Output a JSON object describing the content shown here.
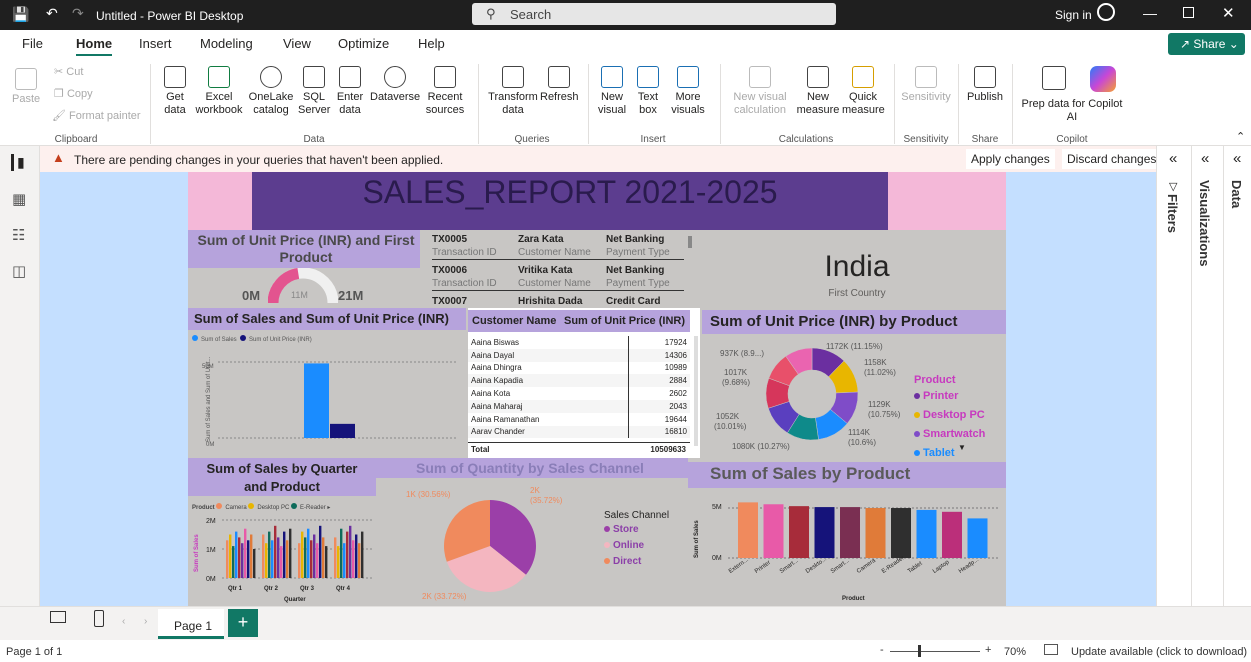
{
  "window": {
    "title": "Untitled - Power BI Desktop",
    "search": "Search",
    "sign_in": "Sign in"
  },
  "menu_tabs": [
    "File",
    "Home",
    "Insert",
    "Modeling",
    "View",
    "Optimize",
    "Help"
  ],
  "share_label": "Share",
  "ribbon": {
    "clipboard": {
      "paste": "Paste",
      "cut": "Cut",
      "copy": "Copy",
      "format_painter": "Format painter",
      "group": "Clipboard"
    },
    "data": {
      "get_data": "Get data",
      "excel": "Excel workbook",
      "onelake": "OneLake catalog",
      "sql": "SQL Server",
      "enter": "Enter data",
      "dataverse": "Dataverse",
      "recent": "Recent sources",
      "group": "Data"
    },
    "queries": {
      "transform": "Transform data",
      "refresh": "Refresh",
      "group": "Queries"
    },
    "insert": {
      "new_visual": "New visual",
      "text_box": "Text box",
      "more_visuals": "More visuals",
      "group": "Insert"
    },
    "calculations": {
      "new_visual_calc": "New visual calculation",
      "new_measure": "New measure",
      "quick_measure": "Quick measure",
      "group": "Calculations"
    },
    "sensitivity": {
      "label": "Sensitivity",
      "group": "Sensitivity"
    },
    "share": {
      "publish": "Publish",
      "group": "Share"
    },
    "copilot": {
      "prep": "Prep data for Copilot AI",
      "group": "Copilot"
    }
  },
  "warning": {
    "text": "There are pending changes in your queries that haven't been applied.",
    "apply": "Apply changes",
    "discard": "Discard changes"
  },
  "panes": {
    "filters": "Filters",
    "visualizations": "Visualizations",
    "data": "Data"
  },
  "report": {
    "title": "SALES_REPORT 2021-2025",
    "gauge": {
      "title": "Sum of Unit Price (INR) and First Product",
      "min": "0M",
      "mid": "11M",
      "max": "21M",
      "value_fraction": 0.45
    },
    "transactions": [
      {
        "id": "TX0005",
        "name": "Zara Kata",
        "payment": "Net Banking"
      },
      {
        "id": "TX0006",
        "name": "Vritika Kata",
        "payment": "Net Banking"
      },
      {
        "id": "TX0007",
        "name": "Hrishita Dada",
        "payment": "Credit Card"
      }
    ],
    "transaction_labels": {
      "id": "Transaction ID",
      "name": "Customer Name",
      "payment": "Payment Type"
    },
    "country_card": {
      "value": "India",
      "label": "First Country"
    },
    "sales_unit_chart": {
      "title": "Sum of Sales and Sum of Unit Price (INR)",
      "legend_sales": "Sum of Sales",
      "legend_unit": "Sum of Unit Price (INR)",
      "ylabel": "Sum of Sales and Sum of Unit...",
      "tick_50m": "50M",
      "tick_0m": "0M"
    },
    "customer_table": {
      "headers": [
        "Customer Name",
        "Sum of Unit Price (INR)"
      ],
      "rows": [
        [
          "Aaina Biswas",
          "17924"
        ],
        [
          "Aaina Dayal",
          "14306"
        ],
        [
          "Aaina Dhingra",
          "10989"
        ],
        [
          "Aaina Kapadia",
          "2884"
        ],
        [
          "Aaina Kota",
          "2602"
        ],
        [
          "Aaina Maharaj",
          "2043"
        ],
        [
          "Aaina Ramanathan",
          "19644"
        ],
        [
          "Aarav Chander",
          "16810"
        ]
      ],
      "total_label": "Total",
      "total_value": "10509633"
    },
    "donut": {
      "title": "Sum of Unit Price (INR) by Product",
      "legend_title": "Product",
      "legend": [
        {
          "name": "Printer",
          "color": "#6b2fa0"
        },
        {
          "name": "Desktop PC",
          "color": "#e8b600"
        },
        {
          "name": "Smartwatch",
          "color": "#7f4cc8"
        },
        {
          "name": "Tablet",
          "color": "#1a8cff"
        }
      ],
      "labels": [
        "1172K (11.15%)",
        "1158K",
        "(11.02%)",
        "1129K",
        "(10.75%)",
        "1114K",
        "(10.6%)",
        "1080K (10.27%)",
        "1052K",
        "(10.01%)",
        "1017K",
        "(9.68%)",
        "937K (8.9...)"
      ]
    },
    "quarter_chart": {
      "title": "Sum of Sales by Quarter and Product",
      "legend_label": "Product",
      "legend": [
        "Camera",
        "Desktop PC",
        "E-Reader"
      ],
      "quarters": [
        "Qtr 1",
        "Qtr 2",
        "Qtr 3",
        "Qtr 4"
      ],
      "xlabel": "Quarter",
      "ylabel": "Sum of Sales",
      "ticks": [
        "2M",
        "1M",
        "0M"
      ]
    },
    "pie": {
      "title": "Sum of Quantity by Sales Channel",
      "legend_title": "Sales Channel",
      "legend": [
        "Store",
        "Online",
        "Direct"
      ],
      "label_direct": "1K (30.56%)",
      "label_store": "2K",
      "label_store2": "(35.72%)",
      "label_online": "2K (33.72%)"
    },
    "product_chart": {
      "title": "Sum of Sales by Product",
      "ylabel": "Sum of Sales",
      "xlabel": "Product",
      "ticks": [
        "5M",
        "0M"
      ]
    }
  },
  "chart_data": [
    {
      "type": "bar",
      "title": "Sum of Sales by Product",
      "categories": [
        "Extern...",
        "Printer",
        "Smart...",
        "Deskto...",
        "Smart...",
        "Camera",
        "E-Reader",
        "Tablet",
        "Laptop",
        "Headp..."
      ],
      "values": [
        5.9,
        5.7,
        5.5,
        5.4,
        5.4,
        5.3,
        5.3,
        5.1,
        4.9,
        4.2
      ],
      "ylabel": "Sum of Sales",
      "xlabel": "Product",
      "ylim": [
        0,
        7
      ],
      "colors": [
        "#f08a5d",
        "#e85aa8",
        "#a72c3a",
        "#15137a",
        "#7a2f52",
        "#e07b39",
        "#2f2f2f",
        "#1a8cff",
        "#bb2f7a",
        "#1a8cff"
      ]
    },
    {
      "type": "pie",
      "title": "Sum of Quantity by Sales Channel",
      "categories": [
        "Store",
        "Online",
        "Direct"
      ],
      "values": [
        35.72,
        33.72,
        30.56
      ],
      "colors": [
        "#9b3fa8",
        "#f4b6c0",
        "#f08a5d"
      ]
    },
    {
      "type": "pie",
      "title": "Sum of Unit Price (INR) by Product",
      "values": [
        11.15,
        11.02,
        10.75,
        10.6,
        10.27,
        10.01,
        9.68,
        8.9,
        8.8
      ],
      "colors": [
        "#6b2fa0",
        "#e8b600",
        "#7f4cc8",
        "#1a8cff",
        "#0e8a8a",
        "#5a3fbf",
        "#d6365b",
        "#e8506a",
        "#ea64b0"
      ]
    },
    {
      "type": "bar",
      "title": "Sum of Sales and Sum of Unit Price (INR)",
      "series": [
        {
          "name": "Sum of Sales",
          "values": [
            58
          ]
        },
        {
          "name": "Sum of Unit Price (INR)",
          "values": [
            11
          ]
        }
      ],
      "ylim": [
        0,
        70
      ]
    },
    {
      "type": "bar",
      "title": "Sum of Sales by Quarter and Product",
      "categories": [
        "Qtr 1",
        "Qtr 2",
        "Qtr 3",
        "Qtr 4"
      ],
      "ylim": [
        0,
        2.4
      ]
    }
  ],
  "pages": {
    "tab": "Page 1",
    "status": "Page 1 of 1",
    "zoom": "70%",
    "update": "Update available (click to download)"
  }
}
